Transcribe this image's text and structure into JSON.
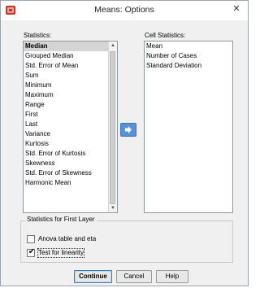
{
  "window": {
    "title": "Means: Options",
    "close_glyph": "✕"
  },
  "statistics": {
    "label": "Statistics:",
    "items": [
      "Median",
      "Grouped Median",
      "Std. Error of Mean",
      "Sum",
      "Minimum",
      "Maximum",
      "Range",
      "First",
      "Last",
      "Variance",
      "Kurtosis",
      "Std. Error of Kurtosis",
      "Skewness",
      "Std. Error of Skewness",
      "Harmonic Mean"
    ],
    "selected_item": "Median"
  },
  "cell_statistics": {
    "label": "Cell Statistics:",
    "items": [
      "Mean",
      "Number of Cases",
      "Standard Deviation"
    ]
  },
  "first_layer": {
    "title": "Statistics for First Layer",
    "anova": {
      "label": "Anova table and eta",
      "checked": false
    },
    "linearity": {
      "label": "Test for linearity",
      "checked": true
    }
  },
  "buttons": {
    "continue": "Continue",
    "cancel": "Cancel",
    "help": "Help"
  },
  "icons": {
    "move": "arrow-right-icon",
    "app": "spss-app-icon",
    "close": "close-icon"
  },
  "colors": {
    "move_button": "#5b8fd8",
    "selection": "#d4d4d4"
  }
}
